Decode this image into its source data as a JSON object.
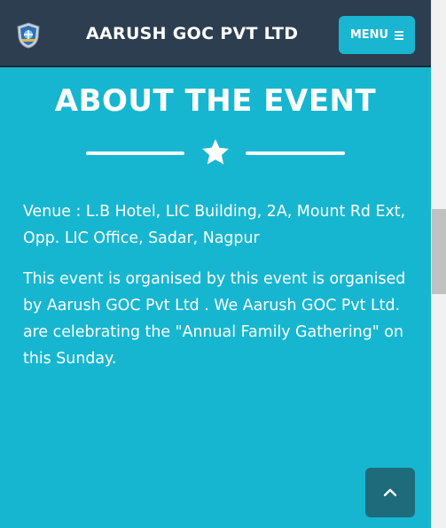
{
  "navbar": {
    "brand": "AARUSH GOC PVT LTD",
    "logo_icon": "shield-logo-icon",
    "menu_label": "MENU",
    "menu_icon": "hamburger-icon"
  },
  "about": {
    "heading": "ABOUT THE EVENT",
    "divider_icon": "star-icon",
    "venue": "Venue : L.B Hotel, LIC Building, 2A, Mount Rd Ext, Opp. LIC Office, Sadar, Nagpur",
    "description": "This event is organised by this event is organised by Aarush GOC Pvt Ltd . We Aarush GOC Pvt Ltd. are celebrating the \"Annual Family Gathering\" on this Sunday."
  },
  "scroll_top": {
    "icon": "chevron-up-icon"
  },
  "colors": {
    "navbar_bg": "#2c3e50",
    "accent": "#1ab6d1",
    "content_bg": "#17b6d0",
    "scroll_top_bg": "#1e6b7c"
  }
}
